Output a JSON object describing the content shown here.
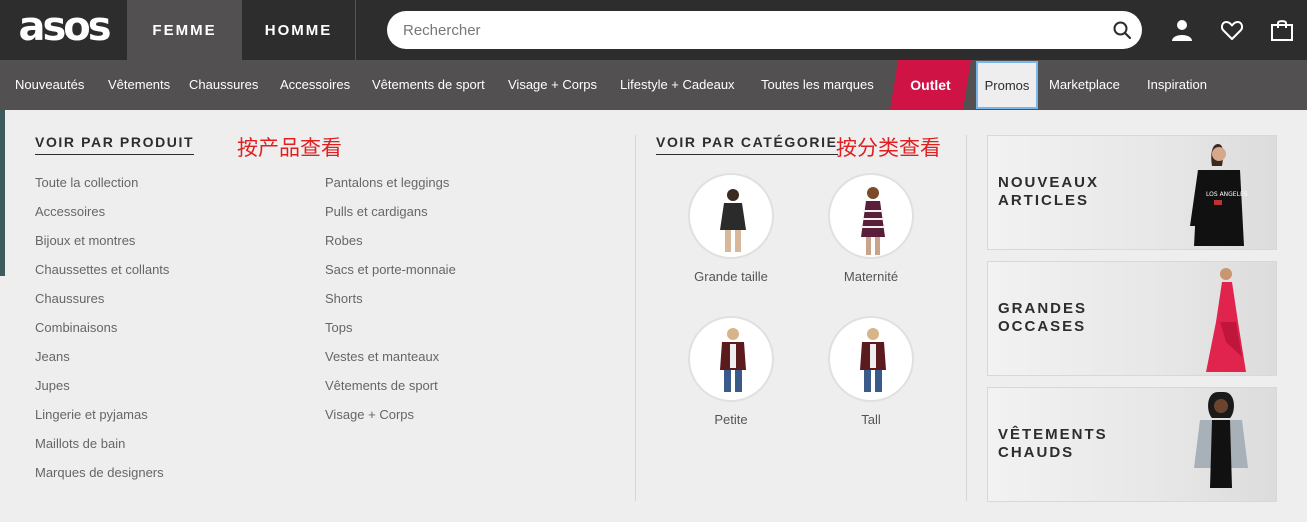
{
  "header": {
    "logo": "asos",
    "tabs": [
      "FEMME",
      "HOMME"
    ],
    "search_placeholder": "Rechercher",
    "icons": [
      "search-icon",
      "user-icon",
      "heart-icon",
      "bag-icon"
    ]
  },
  "nav": {
    "items": [
      "Nouveautés",
      "Vêtements",
      "Chaussures",
      "Accessoires",
      "Vêtements de sport",
      "Visage + Corps",
      "Lifestyle + Cadeaux",
      "Toutes les marques"
    ],
    "outlet": "Outlet",
    "promos": "Promos",
    "after": [
      "Marketplace",
      "Inspiration"
    ],
    "outlet_color": "#d01345"
  },
  "by_product": {
    "title": "VOIR PAR PRODUIT",
    "annotation": "按产品查看",
    "col1": [
      "Toute la collection",
      "Accessoires",
      "Bijoux et montres",
      "Chaussettes et collants",
      "Chaussures",
      "Combinaisons",
      "Jeans",
      "Jupes",
      "Lingerie et pyjamas",
      "Maillots de bain",
      "Marques de designers"
    ],
    "col2": [
      "Pantalons et leggings",
      "Pulls et cardigans",
      "Robes",
      "Sacs et porte-monnaie",
      "Shorts",
      "Tops",
      "Vestes et manteaux",
      "Vêtements de sport",
      "Visage + Corps"
    ]
  },
  "by_category": {
    "title": "VOIR PAR CATÉGORIE",
    "annotation": "按分类查看",
    "items": [
      "Grande taille",
      "Maternité",
      "Petite",
      "Tall"
    ]
  },
  "promos": {
    "cards": [
      {
        "line1": "NOUVEAUX",
        "line2": "ARTICLES"
      },
      {
        "line1": "GRANDES",
        "line2": "OCCASES"
      },
      {
        "line1": "VÊTEMENTS",
        "line2": "CHAUDS"
      }
    ]
  }
}
